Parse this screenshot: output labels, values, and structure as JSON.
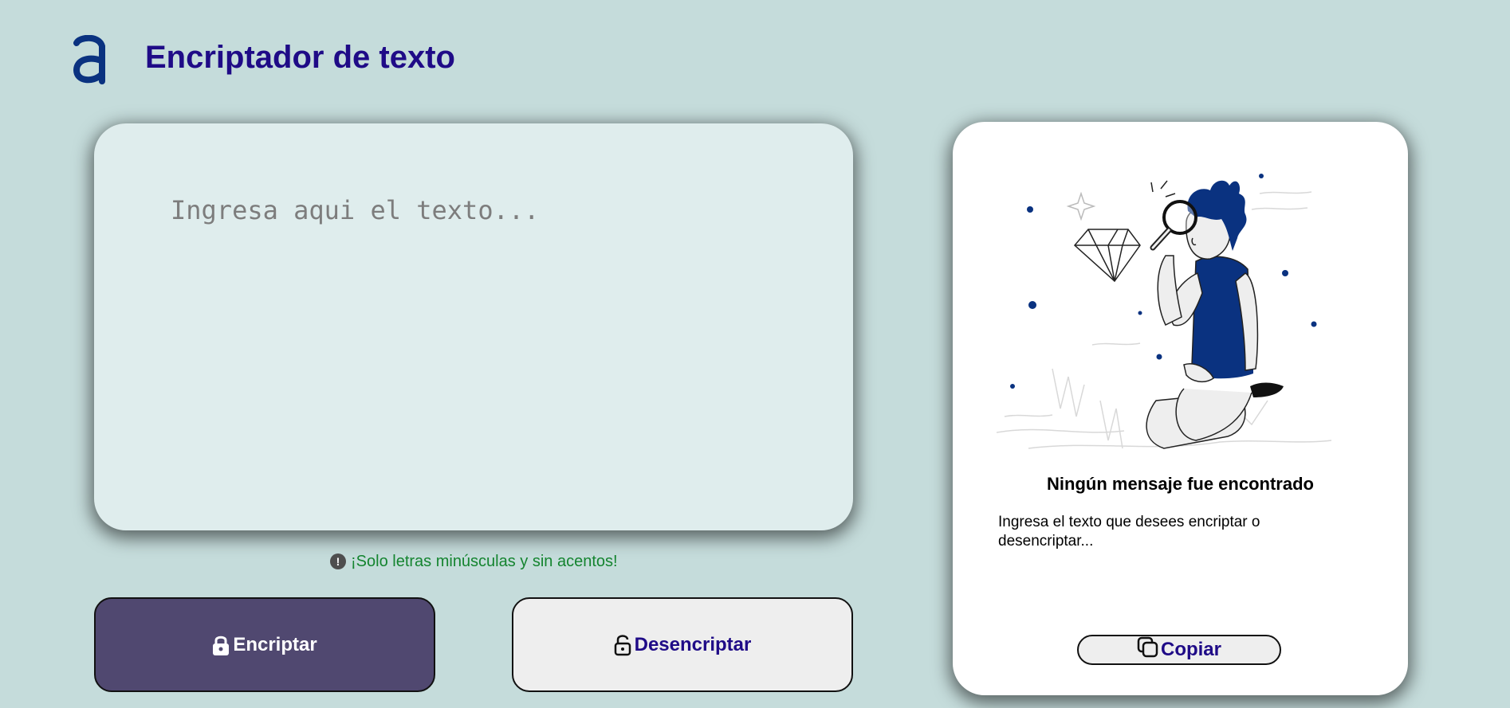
{
  "header": {
    "title": "Encriptador de texto",
    "logo_icon": "alura-logo-icon"
  },
  "input": {
    "placeholder": "Ingresa aqui el texto...",
    "value": ""
  },
  "hint": {
    "icon": "exclamation-circle-icon",
    "text": "¡Solo letras minúsculas y sin acentos!"
  },
  "buttons": {
    "encrypt_label": "Encriptar",
    "encrypt_icon": "lock-icon",
    "decrypt_label": "Desencriptar",
    "decrypt_icon": "unlock-icon"
  },
  "output": {
    "illustration": "person-magnifying-glass-diamond-illustration",
    "title": "Ningún mensaje fue encontrado",
    "description": "Ingresa el texto que desees encriptar o desencriptar...",
    "copy_label": "Copiar",
    "copy_icon": "copy-icon"
  },
  "colors": {
    "background": "#c5dcdb",
    "accent": "#1f0b87",
    "encrypt_button": "#504870",
    "hint": "#14842f",
    "illustration_blue": "#0a3280"
  }
}
